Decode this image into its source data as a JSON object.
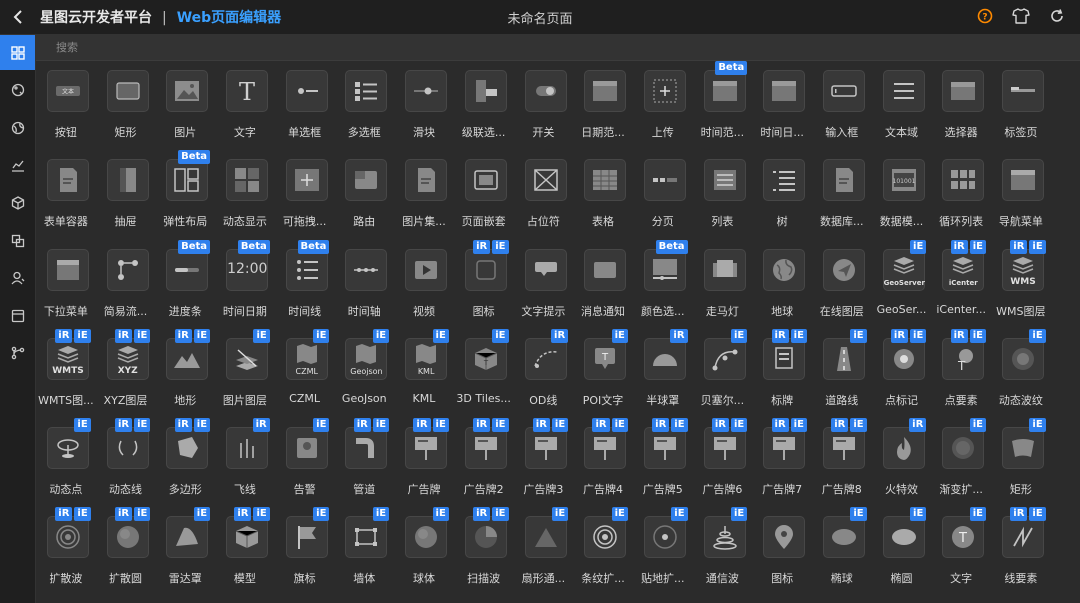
{
  "header": {
    "app_name": "星图云开发者平台",
    "separator": "|",
    "editor_name": "Web页面编辑器",
    "page_title": "未命名页面"
  },
  "colors": {
    "accent": "#2f80ed",
    "brand_sub": "#3aa0ff",
    "help_icon": "#ff8a00"
  },
  "search": {
    "placeholder": "搜索"
  },
  "sidebar_icons": [
    "grid-icon",
    "palette-icon",
    "globe-icon",
    "chart-icon",
    "cube-icon",
    "layers-icon",
    "user-icon",
    "card-icon",
    "branch-icon"
  ],
  "components": [
    {
      "label": "按钮",
      "icon": "button",
      "badges": []
    },
    {
      "label": "矩形",
      "icon": "rect",
      "badges": []
    },
    {
      "label": "图片",
      "icon": "image",
      "badges": []
    },
    {
      "label": "文字",
      "icon": "text",
      "badges": []
    },
    {
      "label": "单选框",
      "icon": "radio",
      "badges": []
    },
    {
      "label": "多选框",
      "icon": "checkbox",
      "badges": []
    },
    {
      "label": "滑块",
      "icon": "slider",
      "badges": []
    },
    {
      "label": "级联选...",
      "icon": "cascader",
      "badges": []
    },
    {
      "label": "开关",
      "icon": "switch",
      "badges": []
    },
    {
      "label": "日期范...",
      "icon": "calendar",
      "badges": []
    },
    {
      "label": "上传",
      "icon": "upload",
      "badges": []
    },
    {
      "label": "时间范...",
      "icon": "calendar",
      "badges": [
        "Beta"
      ]
    },
    {
      "label": "时间日...",
      "icon": "calendar",
      "badges": []
    },
    {
      "label": "输入框",
      "icon": "input",
      "badges": []
    },
    {
      "label": "文本域",
      "icon": "textarea",
      "badges": []
    },
    {
      "label": "选择器",
      "icon": "select",
      "badges": []
    },
    {
      "label": "标签页",
      "icon": "tabs",
      "badges": []
    },
    {
      "label": "表单容器",
      "icon": "doc",
      "badges": []
    },
    {
      "label": "抽屉",
      "icon": "drawer",
      "badges": []
    },
    {
      "label": "弹性布局",
      "icon": "flex",
      "badges": [
        "Beta"
      ]
    },
    {
      "label": "动态显示",
      "icon": "dyn",
      "badges": []
    },
    {
      "label": "可拖拽...",
      "icon": "drag",
      "badges": []
    },
    {
      "label": "路由",
      "icon": "route",
      "badges": []
    },
    {
      "label": "图片集...",
      "icon": "doc",
      "badges": []
    },
    {
      "label": "页面嵌套",
      "icon": "nest",
      "badges": []
    },
    {
      "label": "占位符",
      "icon": "placeholder",
      "badges": []
    },
    {
      "label": "表格",
      "icon": "table",
      "badges": []
    },
    {
      "label": "分页",
      "icon": "pagination",
      "badges": []
    },
    {
      "label": "列表",
      "icon": "list",
      "badges": []
    },
    {
      "label": "树",
      "icon": "tree",
      "badges": []
    },
    {
      "label": "数据库...",
      "icon": "doc",
      "badges": []
    },
    {
      "label": "数据模...",
      "icon": "datamodel",
      "badges": []
    },
    {
      "label": "循环列表",
      "icon": "loop",
      "badges": []
    },
    {
      "label": "导航菜单",
      "icon": "nav",
      "badges": []
    },
    {
      "label": "下拉菜单",
      "icon": "dropdown",
      "badges": []
    },
    {
      "label": "简易流...",
      "icon": "flow",
      "badges": []
    },
    {
      "label": "进度条",
      "icon": "progress",
      "badges": [
        "Beta"
      ]
    },
    {
      "label": "时间日期",
      "icon": "clock",
      "badges": [
        "Beta"
      ],
      "text": "12:00"
    },
    {
      "label": "时间线",
      "icon": "timeline",
      "badges": [
        "Beta"
      ]
    },
    {
      "label": "时间轴",
      "icon": "timeaxis",
      "badges": []
    },
    {
      "label": "视频",
      "icon": "video",
      "badges": []
    },
    {
      "label": "图标",
      "icon": "iconbox",
      "badges": [
        "iR",
        "iE"
      ]
    },
    {
      "label": "文字提示",
      "icon": "tooltip",
      "badges": []
    },
    {
      "label": "消息通知",
      "icon": "message",
      "badges": []
    },
    {
      "label": "颜色选...",
      "icon": "color",
      "badges": [
        "Beta"
      ]
    },
    {
      "label": "走马灯",
      "icon": "carousel",
      "badges": []
    },
    {
      "label": "地球",
      "icon": "earth",
      "badges": []
    },
    {
      "label": "在线图层",
      "icon": "online",
      "badges": []
    },
    {
      "label": "GeoSer...",
      "icon": "stack",
      "badges": [
        "iE"
      ],
      "text": "GeoServer"
    },
    {
      "label": "iCenter...",
      "icon": "stack",
      "badges": [
        "iR",
        "iE"
      ],
      "text": "iCenter"
    },
    {
      "label": "WMS图层",
      "icon": "stack",
      "badges": [
        "iR",
        "iE"
      ],
      "text": "WMS"
    },
    {
      "label": "WMTS图...",
      "icon": "stack",
      "badges": [
        "iR",
        "iE"
      ],
      "text": "WMTS"
    },
    {
      "label": "XYZ图层",
      "icon": "stack",
      "badges": [
        "iR",
        "iE"
      ],
      "text": "XYZ"
    },
    {
      "label": "地形",
      "icon": "terrain",
      "badges": [
        "iR",
        "iE"
      ]
    },
    {
      "label": "图片图层",
      "icon": "imglayer",
      "badges": [
        "iE"
      ]
    },
    {
      "label": "CZML",
      "icon": "mapfold",
      "badges": [
        "iE"
      ],
      "text": "CZML"
    },
    {
      "label": "GeoJson",
      "icon": "mapfold",
      "badges": [
        "iE"
      ],
      "text": "Geojson"
    },
    {
      "label": "KML",
      "icon": "mapfold",
      "badges": [
        "iE"
      ],
      "text": "KML"
    },
    {
      "label": "3D Tiles...",
      "icon": "cube3d",
      "badges": [
        "iE"
      ]
    },
    {
      "label": "OD线",
      "icon": "odline",
      "badges": [
        "iR"
      ]
    },
    {
      "label": "POI文字",
      "icon": "poi",
      "badges": [
        "iE"
      ]
    },
    {
      "label": "半球罩",
      "icon": "hemi",
      "badges": [
        "iR"
      ]
    },
    {
      "label": "贝塞尔...",
      "icon": "bezier",
      "badges": [
        "iE"
      ]
    },
    {
      "label": "标牌",
      "icon": "sign",
      "badges": [
        "iR",
        "iE"
      ]
    },
    {
      "label": "道路线",
      "icon": "road",
      "badges": [
        "iE"
      ]
    },
    {
      "label": "点标记",
      "icon": "point",
      "badges": [
        "iR",
        "iE"
      ]
    },
    {
      "label": "点要素",
      "icon": "pointfeat",
      "badges": [
        "iR",
        "iE"
      ]
    },
    {
      "label": "动态波纹",
      "icon": "ripple",
      "badges": [
        "iE"
      ]
    },
    {
      "label": "动态点",
      "icon": "dynpoint",
      "badges": [
        "iE"
      ]
    },
    {
      "label": "动态线",
      "icon": "dynline",
      "badges": [
        "iR",
        "iE"
      ]
    },
    {
      "label": "多边形",
      "icon": "polygon",
      "badges": [
        "iR",
        "iE"
      ]
    },
    {
      "label": "飞线",
      "icon": "flyline",
      "badges": [
        "iR"
      ]
    },
    {
      "label": "告警",
      "icon": "alarm",
      "badges": [
        "iE"
      ]
    },
    {
      "label": "管道",
      "icon": "pipe",
      "badges": [
        "iR",
        "iE"
      ]
    },
    {
      "label": "广告牌",
      "icon": "billboard",
      "badges": [
        "iR",
        "iE"
      ]
    },
    {
      "label": "广告牌2",
      "icon": "billboard",
      "badges": [
        "iR",
        "iE"
      ]
    },
    {
      "label": "广告牌3",
      "icon": "billboard",
      "badges": [
        "iR",
        "iE"
      ]
    },
    {
      "label": "广告牌4",
      "icon": "billboard",
      "badges": [
        "iR",
        "iE"
      ]
    },
    {
      "label": "广告牌5",
      "icon": "billboard",
      "badges": [
        "iR",
        "iE"
      ]
    },
    {
      "label": "广告牌6",
      "icon": "billboard",
      "badges": [
        "iR",
        "iE"
      ]
    },
    {
      "label": "广告牌7",
      "icon": "billboard",
      "badges": [
        "iR",
        "iE"
      ]
    },
    {
      "label": "广告牌8",
      "icon": "billboard",
      "badges": [
        "iR",
        "iE"
      ]
    },
    {
      "label": "火特效",
      "icon": "fire",
      "badges": [
        "iR"
      ]
    },
    {
      "label": "渐变扩...",
      "icon": "gradient",
      "badges": [
        "iE"
      ]
    },
    {
      "label": "矩形",
      "icon": "curverect",
      "badges": [
        "iE"
      ]
    },
    {
      "label": "扩散波",
      "icon": "spreadwave",
      "badges": [
        "iR",
        "iE"
      ]
    },
    {
      "label": "扩散圆",
      "icon": "sphere",
      "badges": [
        "iR",
        "iE"
      ]
    },
    {
      "label": "雷达罩",
      "icon": "radar",
      "badges": [
        "iE"
      ]
    },
    {
      "label": "模型",
      "icon": "model",
      "badges": [
        "iR",
        "iE"
      ]
    },
    {
      "label": "旗标",
      "icon": "flag",
      "badges": [
        "iE"
      ]
    },
    {
      "label": "墙体",
      "icon": "wall",
      "badges": [
        "iE"
      ]
    },
    {
      "label": "球体",
      "icon": "sphere",
      "badges": [
        "iE"
      ]
    },
    {
      "label": "扫描波",
      "icon": "scan",
      "badges": [
        "iR",
        "iE"
      ]
    },
    {
      "label": "扇形通...",
      "icon": "fan",
      "badges": [
        "iE"
      ]
    },
    {
      "label": "条纹扩...",
      "icon": "stripe",
      "badges": [
        "iE"
      ]
    },
    {
      "label": "贴地扩...",
      "icon": "ground",
      "badges": [
        "iE"
      ]
    },
    {
      "label": "通信波",
      "icon": "comm",
      "badges": [
        "iE"
      ]
    },
    {
      "label": "图标",
      "icon": "mappin",
      "badges": []
    },
    {
      "label": "椭球",
      "icon": "ellipsoid",
      "badges": [
        "iE"
      ]
    },
    {
      "label": "椭圆",
      "icon": "ellipse",
      "badges": [
        "iE"
      ]
    },
    {
      "label": "文字",
      "icon": "textT",
      "badges": [
        "iE"
      ]
    },
    {
      "label": "线要素",
      "icon": "linefeat",
      "badges": [
        "iR",
        "iE"
      ]
    }
  ]
}
